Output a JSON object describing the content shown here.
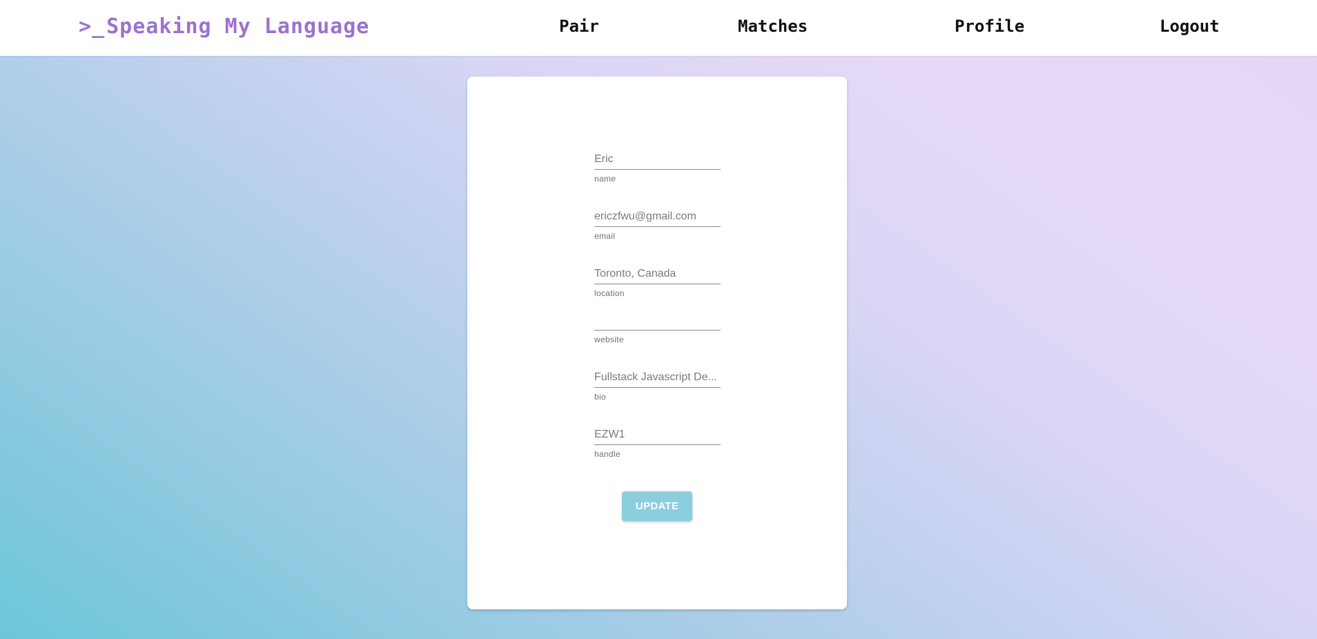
{
  "navbar": {
    "brand_prompt": ">_",
    "brand_title": "Speaking My Language",
    "links": [
      {
        "label": "Pair"
      },
      {
        "label": "Matches"
      },
      {
        "label": "Profile"
      },
      {
        "label": "Logout"
      }
    ]
  },
  "profile_form": {
    "fields": {
      "name": {
        "value": "Eric",
        "helper": "name"
      },
      "email": {
        "value": "ericzfwu@gmail.com",
        "helper": "email"
      },
      "location": {
        "value": "Toronto, Canada",
        "helper": "location"
      },
      "website": {
        "value": "",
        "helper": "website"
      },
      "bio": {
        "value": "Fullstack Javascript De...",
        "helper": "bio"
      },
      "handle": {
        "value": "EZW1",
        "helper": "handle"
      }
    },
    "update_label": "UPDATE"
  },
  "colors": {
    "brand": "#9b72cf",
    "button": "#8bcfdf",
    "background_gradient": [
      "#6cc6d8",
      "#bfd1ee",
      "#e6d8f8"
    ]
  }
}
